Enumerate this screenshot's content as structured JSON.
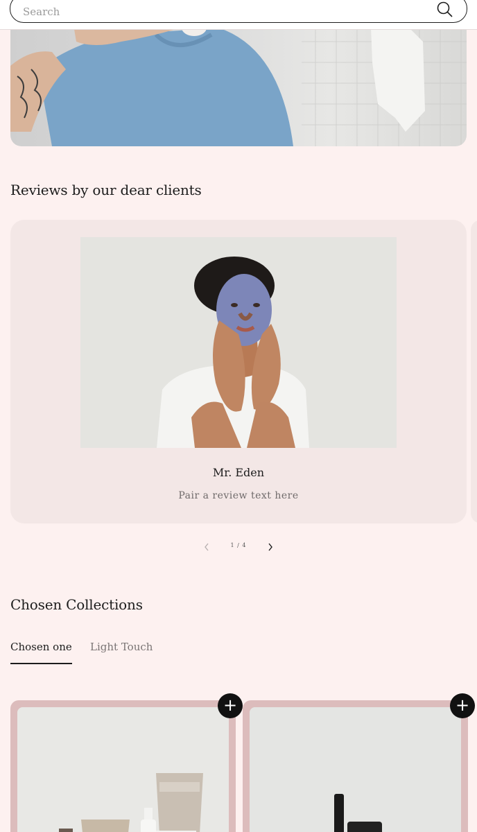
{
  "search": {
    "placeholder": "Search"
  },
  "reviews": {
    "title": "Reviews by our dear clients",
    "items": [
      {
        "name": "Mr. Eden",
        "text": "Pair a review text here"
      }
    ],
    "counter": "1 / 4"
  },
  "collections": {
    "title": "Chosen Collections",
    "tabs": [
      {
        "label": "Chosen one",
        "active": true
      },
      {
        "label": "Light Touch",
        "active": false
      }
    ]
  },
  "colors": {
    "background": "#fdf1f0",
    "card": "#f3e7e6",
    "product_frame": "#dcbcbc",
    "accent": "#111111"
  },
  "icons": {
    "search": "search-icon",
    "prev": "chevron-left-icon",
    "next": "chevron-right-icon",
    "add": "plus-icon"
  }
}
